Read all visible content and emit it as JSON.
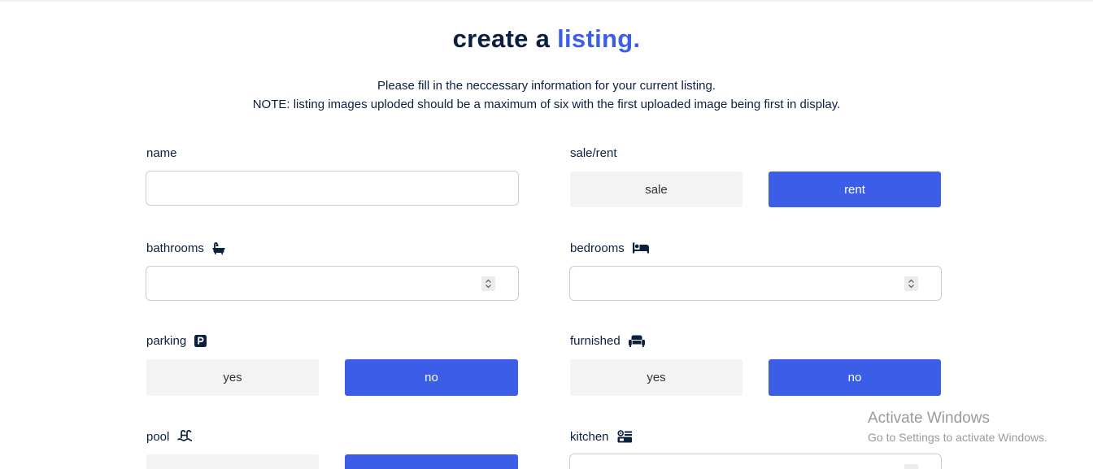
{
  "header": {
    "title_main": "create a ",
    "title_accent": "listing."
  },
  "intro": {
    "line1": "Please fill in the neccessary information for your current listing.",
    "line2": "NOTE: listing images uploded should be a maximum of six with the first uploaded image being first in display."
  },
  "form": {
    "name": {
      "label": "name",
      "value": ""
    },
    "sale_rent": {
      "label": "sale/rent",
      "options": [
        "sale",
        "rent"
      ],
      "selected": "rent"
    },
    "bathrooms": {
      "label": "bathrooms",
      "icon": "bath-icon",
      "value": ""
    },
    "bedrooms": {
      "label": "bedrooms",
      "icon": "bed-icon",
      "value": ""
    },
    "parking": {
      "label": "parking",
      "icon": "parking-icon",
      "options": [
        "yes",
        "no"
      ],
      "selected": "no"
    },
    "furnished": {
      "label": "furnished",
      "icon": "couch-icon",
      "options": [
        "yes",
        "no"
      ],
      "selected": "no"
    },
    "pool": {
      "label": "pool",
      "icon": "pool-icon"
    },
    "kitchen": {
      "label": "kitchen",
      "icon": "kitchen-icon"
    }
  },
  "watermark": {
    "line1": "Activate Windows",
    "line2": "Go to Settings to activate Windows."
  },
  "colors": {
    "accent": "#3b5de7",
    "text": "#0b1f3f",
    "inactive_button": "#f3f3f3"
  }
}
